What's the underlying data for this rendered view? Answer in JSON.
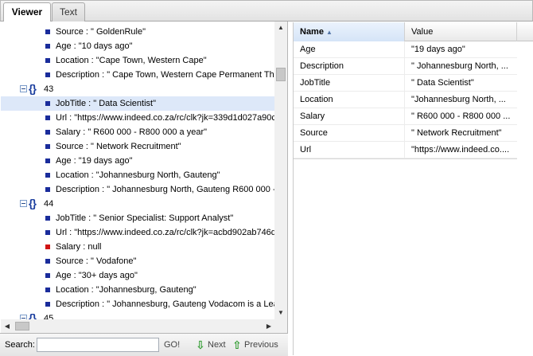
{
  "tabs": [
    {
      "label": "Viewer"
    },
    {
      "label": "Text"
    }
  ],
  "tree": {
    "rows": [
      {
        "type": "prop",
        "text": "Source : \" GoldenRule\""
      },
      {
        "type": "prop",
        "text": "Age : \"10 days ago\""
      },
      {
        "type": "prop",
        "text": "Location : \"Cape Town, Western Cape\""
      },
      {
        "type": "prop",
        "text": "Description : \" Cape Town, Western Cape Permanent Th"
      },
      {
        "type": "object",
        "text": "43"
      },
      {
        "type": "prop",
        "text": "JobTitle : \" Data Scientist\"",
        "selected": true
      },
      {
        "type": "prop",
        "text": "Url : \"https://www.indeed.co.za/rc/clk?jk=339d1d027a90c"
      },
      {
        "type": "prop",
        "text": "Salary : \" R600 000 - R800 000 a year\""
      },
      {
        "type": "prop",
        "text": "Source : \" Network Recruitment\""
      },
      {
        "type": "prop",
        "text": "Age : \"19 days ago\""
      },
      {
        "type": "prop",
        "text": "Location : \"Johannesburg North, Gauteng\""
      },
      {
        "type": "prop",
        "text": "Description : \" Johannesburg North, Gauteng R600 000 -"
      },
      {
        "type": "object",
        "text": "44"
      },
      {
        "type": "prop",
        "text": "JobTitle : \" Senior Specialist: Support Analyst\""
      },
      {
        "type": "prop",
        "text": "Url : \"https://www.indeed.co.za/rc/clk?jk=acbd902ab746d"
      },
      {
        "type": "null",
        "text": "Salary : null"
      },
      {
        "type": "prop",
        "text": "Source : \" Vodafone\""
      },
      {
        "type": "prop",
        "text": "Age : \"30+ days ago\""
      },
      {
        "type": "prop",
        "text": "Location : \"Johannesburg, Gauteng\""
      },
      {
        "type": "prop",
        "text": "Description : \" Johannesburg, Gauteng Vodacom is a Lea"
      },
      {
        "type": "object",
        "text": "45"
      }
    ]
  },
  "search": {
    "label": "Search:",
    "value": "",
    "go_label": "GO!",
    "next_label": "Next",
    "previous_label": "Previous"
  },
  "grid": {
    "headers": {
      "name": "Name",
      "value": "Value"
    },
    "rows": [
      {
        "name": "Age",
        "value": "\"19 days ago\""
      },
      {
        "name": "Description",
        "value": "\" Johannesburg North, ..."
      },
      {
        "name": "JobTitle",
        "value": "\" Data Scientist\""
      },
      {
        "name": "Location",
        "value": "\"Johannesburg North, ..."
      },
      {
        "name": "Salary",
        "value": "\" R600 000 - R800 000 ..."
      },
      {
        "name": "Source",
        "value": "\" Network Recruitment\""
      },
      {
        "name": "Url",
        "value": "\"https://www.indeed.co...."
      }
    ]
  },
  "colors": {
    "bullet": "#1a2c9b",
    "null_bullet": "#d01313",
    "selected_row": "#dde8f9",
    "object_brace": "#1c3f9f",
    "nav_arrow": "#2c9a2c"
  }
}
